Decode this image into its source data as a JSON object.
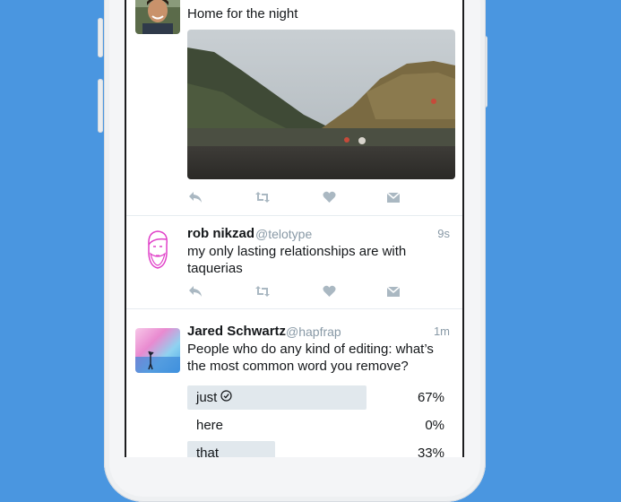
{
  "tweets": [
    {
      "text": "Home for the night",
      "has_photo": true
    },
    {
      "name": "rob nikzad",
      "handle": "@telotype",
      "time": "9s",
      "text": "my only lasting relationships are with taquerias"
    },
    {
      "name": "Jared Schwartz",
      "handle": "@hapfrap",
      "time": "1m",
      "text": "People who do any kind of editing: what’s the most common word you remove?",
      "poll": [
        {
          "label": "just",
          "percent": "67%",
          "fraction": 0.67,
          "selected": true
        },
        {
          "label": "here",
          "percent": "0%",
          "fraction": 0.0,
          "selected": false
        },
        {
          "label": "that",
          "percent": "33%",
          "fraction": 0.33,
          "selected": false
        }
      ]
    }
  ],
  "actions": [
    "reply-icon",
    "retweet-icon",
    "like-icon",
    "direct-message-icon"
  ],
  "colors": {
    "background": "#4a96e0",
    "icon": "#aab8c2",
    "text": "#14171a",
    "secondary": "#8899a6",
    "poll_bar": "#e1e8ed"
  }
}
